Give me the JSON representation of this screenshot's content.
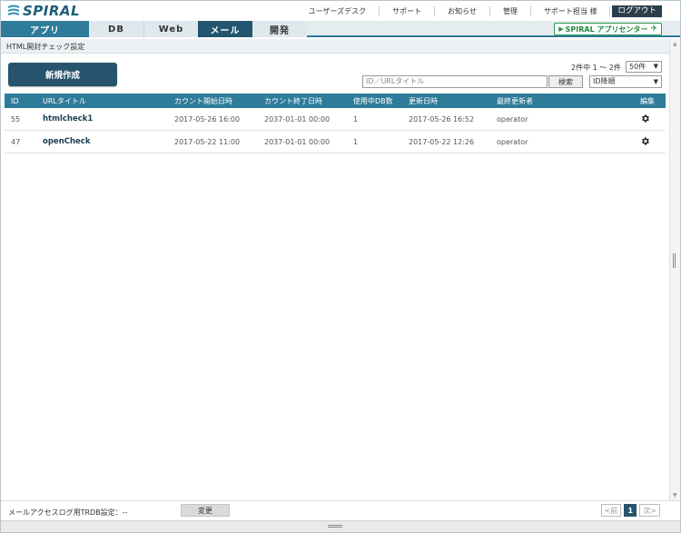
{
  "header": {
    "logo_text": "SPIRAL",
    "links": [
      "ユーザーズデスク",
      "サポート",
      "お知らせ",
      "管理",
      "サポート担当 様"
    ],
    "logout": "ログアウト"
  },
  "tabs": {
    "app": "アプリ",
    "db": "DB",
    "web": "Web",
    "mail": "メール",
    "dev": "開発",
    "app_center": "SPIRAL アプリセンター"
  },
  "breadcrumb": "HTML開封チェック設定",
  "toolbar": {
    "new_button": "新規作成",
    "count": "2件中 1 ～ 2件",
    "per_page": "50件",
    "search_placeholder": "ID／URLタイトル",
    "search_button": "検索",
    "sort": "ID降順"
  },
  "table": {
    "columns": [
      "ID",
      "URLタイトル",
      "カウント開始日時",
      "カウント終了日時",
      "使用中DB数",
      "更新日時",
      "最終更新者",
      "編集"
    ],
    "rows": [
      {
        "id": "55",
        "title": "htmlcheck1",
        "start": "2017-05-26 16:00",
        "end": "2037-01-01 00:00",
        "db": "1",
        "updated": "2017-05-26 16:52",
        "user": "operator"
      },
      {
        "id": "47",
        "title": "openCheck",
        "start": "2017-05-22 11:00",
        "end": "2037-01-01 00:00",
        "db": "1",
        "updated": "2017-05-22 12:26",
        "user": "operator"
      }
    ]
  },
  "footer": {
    "label": "メールアクセスログ用TRDB設定：--",
    "change_button": "変更",
    "prev": "<前",
    "page": "1",
    "next": "次>"
  },
  "colors": {
    "accent": "#2e7b9a",
    "active_tab": "#22566e",
    "button": "#27546c",
    "app_center": "#1f8a3c"
  }
}
